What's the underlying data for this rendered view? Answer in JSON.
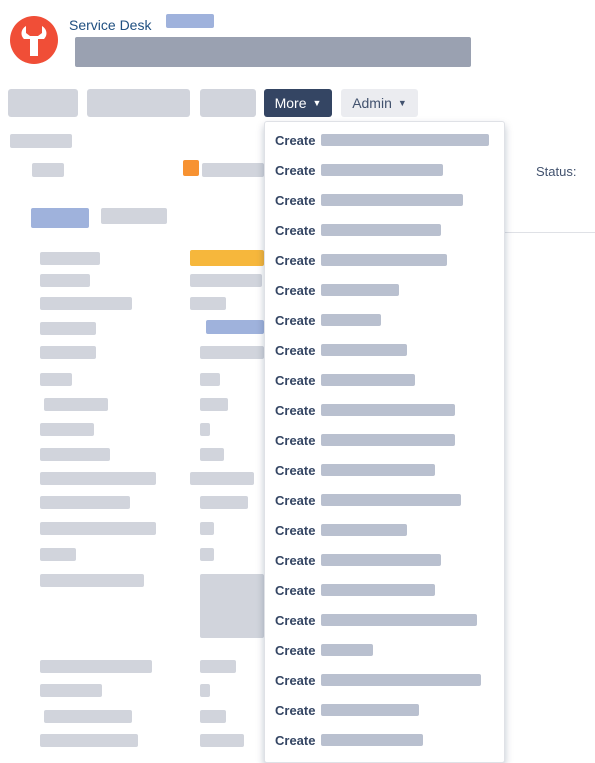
{
  "header": {
    "breadcrumb": "Service Desk",
    "logo_icon": "service-desk-logo-icon"
  },
  "toolbar": {
    "more_label": "More",
    "admin_label": "Admin"
  },
  "status": {
    "label": "Status:"
  },
  "more_menu": {
    "items": [
      {
        "label": "Create"
      },
      {
        "label": "Create"
      },
      {
        "label": "Create"
      },
      {
        "label": "Create"
      },
      {
        "label": "Create"
      },
      {
        "label": "Create"
      },
      {
        "label": "Create"
      },
      {
        "label": "Create"
      },
      {
        "label": "Create"
      },
      {
        "label": "Create"
      },
      {
        "label": "Create"
      },
      {
        "label": "Create"
      },
      {
        "label": "Create"
      },
      {
        "label": "Create"
      },
      {
        "label": "Create"
      },
      {
        "label": "Create"
      },
      {
        "label": "Create"
      },
      {
        "label": "Create"
      },
      {
        "label": "Create"
      },
      {
        "label": "Create"
      },
      {
        "label": "Create"
      }
    ]
  },
  "colors": {
    "more_button_bg": "#344563",
    "admin_button_bg": "#ebecf0",
    "logo_red": "#f04e37",
    "breadcrumb_link": "#205081"
  }
}
